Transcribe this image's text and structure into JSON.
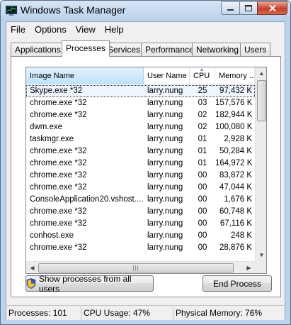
{
  "window": {
    "title": "Windows Task Manager"
  },
  "caption": {
    "minimize_icon": "minimize-icon",
    "maximize_icon": "maximize-icon",
    "close_icon": "close-icon"
  },
  "menu": [
    "File",
    "Options",
    "View",
    "Help"
  ],
  "tabs": [
    {
      "label": "Applications",
      "active": false
    },
    {
      "label": "Processes",
      "active": true
    },
    {
      "label": "Services",
      "active": false
    },
    {
      "label": "Performance",
      "active": false
    },
    {
      "label": "Networking",
      "active": false
    },
    {
      "label": "Users",
      "active": false
    }
  ],
  "columns": [
    "Image Name",
    "User Name",
    "CPU",
    "Memory ..."
  ],
  "sorted_column": "CPU",
  "processes": [
    {
      "name": "Skype.exe *32",
      "user": "larry.nung",
      "cpu": "25",
      "mem": "97,432 K",
      "selected": true
    },
    {
      "name": "chrome.exe *32",
      "user": "larry.nung",
      "cpu": "03",
      "mem": "157,576 K"
    },
    {
      "name": "chrome.exe *32",
      "user": "larry.nung",
      "cpu": "02",
      "mem": "182,944 K"
    },
    {
      "name": "dwm.exe",
      "user": "larry.nung",
      "cpu": "02",
      "mem": "100,080 K"
    },
    {
      "name": "taskmgr.exe",
      "user": "larry.nung",
      "cpu": "01",
      "mem": "2,928 K"
    },
    {
      "name": "chrome.exe *32",
      "user": "larry.nung",
      "cpu": "01",
      "mem": "50,284 K"
    },
    {
      "name": "chrome.exe *32",
      "user": "larry.nung",
      "cpu": "01",
      "mem": "164,972 K"
    },
    {
      "name": "chrome.exe *32",
      "user": "larry.nung",
      "cpu": "00",
      "mem": "83,872 K"
    },
    {
      "name": "chrome.exe *32",
      "user": "larry.nung",
      "cpu": "00",
      "mem": "47,044 K"
    },
    {
      "name": "ConsoleApplication20.vshost....",
      "user": "larry.nung",
      "cpu": "00",
      "mem": "1,676 K"
    },
    {
      "name": "chrome.exe *32",
      "user": "larry.nung",
      "cpu": "00",
      "mem": "60,748 K"
    },
    {
      "name": "chrome.exe *32",
      "user": "larry.nung",
      "cpu": "00",
      "mem": "67,116 K"
    },
    {
      "name": "conhost.exe",
      "user": "larry.nung",
      "cpu": "00",
      "mem": "248 K"
    },
    {
      "name": "chrome.exe *32",
      "user": "larry.nung",
      "cpu": "00",
      "mem": "28,876 K"
    }
  ],
  "buttons": {
    "show_all": "Show processes from all users",
    "end_process": "End Process"
  },
  "status": {
    "processes": "Processes: 101",
    "cpu": "CPU Usage: 47%",
    "memory": "Physical Memory: 76%"
  },
  "colors": {
    "selection": "#eef5fc",
    "sorted_header": "#bfe1fa",
    "frame": "#bcd3ec",
    "close_button": "#c2402a"
  }
}
